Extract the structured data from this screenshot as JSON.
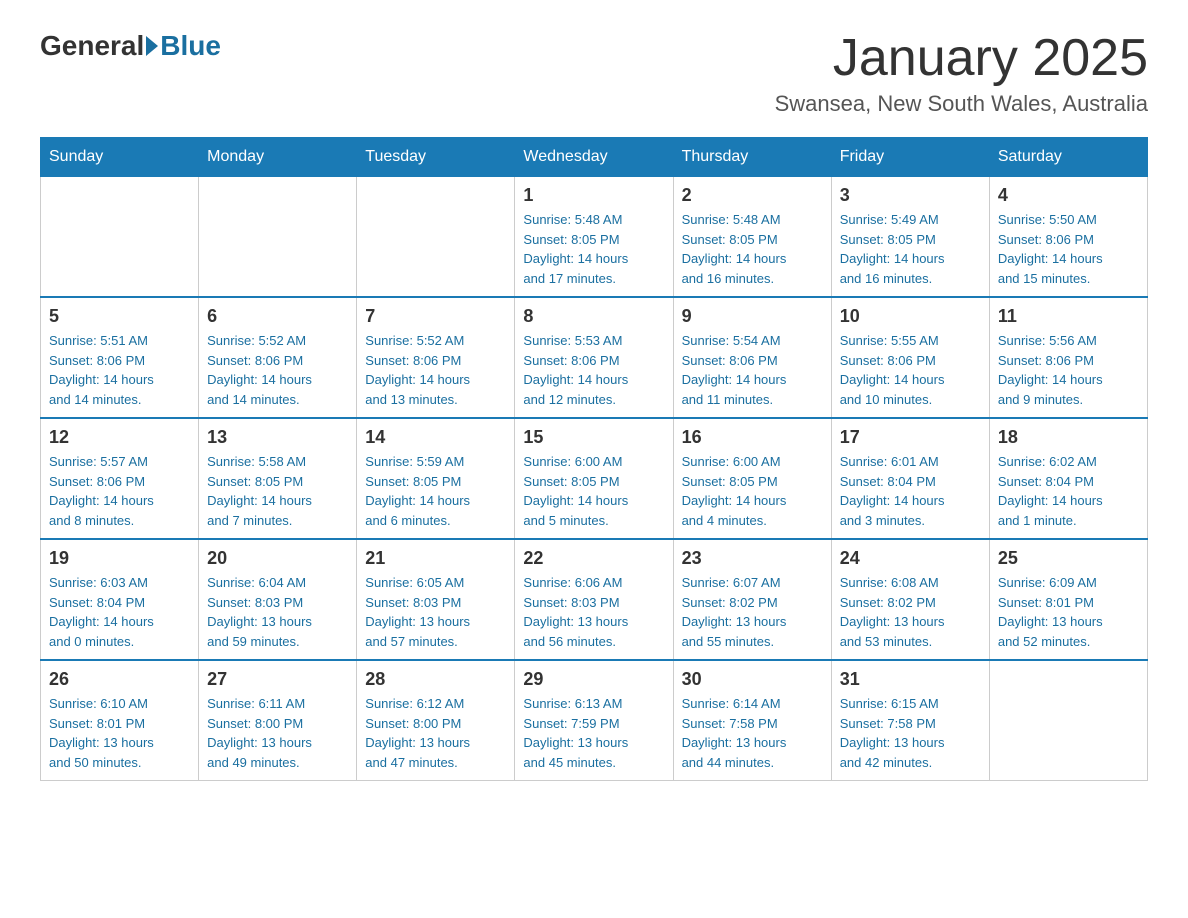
{
  "header": {
    "logo_general": "General",
    "logo_blue": "Blue",
    "month_title": "January 2025",
    "location": "Swansea, New South Wales, Australia"
  },
  "days_of_week": [
    "Sunday",
    "Monday",
    "Tuesday",
    "Wednesday",
    "Thursday",
    "Friday",
    "Saturday"
  ],
  "weeks": [
    [
      {
        "day": "",
        "info": ""
      },
      {
        "day": "",
        "info": ""
      },
      {
        "day": "",
        "info": ""
      },
      {
        "day": "1",
        "info": "Sunrise: 5:48 AM\nSunset: 8:05 PM\nDaylight: 14 hours\nand 17 minutes."
      },
      {
        "day": "2",
        "info": "Sunrise: 5:48 AM\nSunset: 8:05 PM\nDaylight: 14 hours\nand 16 minutes."
      },
      {
        "day": "3",
        "info": "Sunrise: 5:49 AM\nSunset: 8:05 PM\nDaylight: 14 hours\nand 16 minutes."
      },
      {
        "day": "4",
        "info": "Sunrise: 5:50 AM\nSunset: 8:06 PM\nDaylight: 14 hours\nand 15 minutes."
      }
    ],
    [
      {
        "day": "5",
        "info": "Sunrise: 5:51 AM\nSunset: 8:06 PM\nDaylight: 14 hours\nand 14 minutes."
      },
      {
        "day": "6",
        "info": "Sunrise: 5:52 AM\nSunset: 8:06 PM\nDaylight: 14 hours\nand 14 minutes."
      },
      {
        "day": "7",
        "info": "Sunrise: 5:52 AM\nSunset: 8:06 PM\nDaylight: 14 hours\nand 13 minutes."
      },
      {
        "day": "8",
        "info": "Sunrise: 5:53 AM\nSunset: 8:06 PM\nDaylight: 14 hours\nand 12 minutes."
      },
      {
        "day": "9",
        "info": "Sunrise: 5:54 AM\nSunset: 8:06 PM\nDaylight: 14 hours\nand 11 minutes."
      },
      {
        "day": "10",
        "info": "Sunrise: 5:55 AM\nSunset: 8:06 PM\nDaylight: 14 hours\nand 10 minutes."
      },
      {
        "day": "11",
        "info": "Sunrise: 5:56 AM\nSunset: 8:06 PM\nDaylight: 14 hours\nand 9 minutes."
      }
    ],
    [
      {
        "day": "12",
        "info": "Sunrise: 5:57 AM\nSunset: 8:06 PM\nDaylight: 14 hours\nand 8 minutes."
      },
      {
        "day": "13",
        "info": "Sunrise: 5:58 AM\nSunset: 8:05 PM\nDaylight: 14 hours\nand 7 minutes."
      },
      {
        "day": "14",
        "info": "Sunrise: 5:59 AM\nSunset: 8:05 PM\nDaylight: 14 hours\nand 6 minutes."
      },
      {
        "day": "15",
        "info": "Sunrise: 6:00 AM\nSunset: 8:05 PM\nDaylight: 14 hours\nand 5 minutes."
      },
      {
        "day": "16",
        "info": "Sunrise: 6:00 AM\nSunset: 8:05 PM\nDaylight: 14 hours\nand 4 minutes."
      },
      {
        "day": "17",
        "info": "Sunrise: 6:01 AM\nSunset: 8:04 PM\nDaylight: 14 hours\nand 3 minutes."
      },
      {
        "day": "18",
        "info": "Sunrise: 6:02 AM\nSunset: 8:04 PM\nDaylight: 14 hours\nand 1 minute."
      }
    ],
    [
      {
        "day": "19",
        "info": "Sunrise: 6:03 AM\nSunset: 8:04 PM\nDaylight: 14 hours\nand 0 minutes."
      },
      {
        "day": "20",
        "info": "Sunrise: 6:04 AM\nSunset: 8:03 PM\nDaylight: 13 hours\nand 59 minutes."
      },
      {
        "day": "21",
        "info": "Sunrise: 6:05 AM\nSunset: 8:03 PM\nDaylight: 13 hours\nand 57 minutes."
      },
      {
        "day": "22",
        "info": "Sunrise: 6:06 AM\nSunset: 8:03 PM\nDaylight: 13 hours\nand 56 minutes."
      },
      {
        "day": "23",
        "info": "Sunrise: 6:07 AM\nSunset: 8:02 PM\nDaylight: 13 hours\nand 55 minutes."
      },
      {
        "day": "24",
        "info": "Sunrise: 6:08 AM\nSunset: 8:02 PM\nDaylight: 13 hours\nand 53 minutes."
      },
      {
        "day": "25",
        "info": "Sunrise: 6:09 AM\nSunset: 8:01 PM\nDaylight: 13 hours\nand 52 minutes."
      }
    ],
    [
      {
        "day": "26",
        "info": "Sunrise: 6:10 AM\nSunset: 8:01 PM\nDaylight: 13 hours\nand 50 minutes."
      },
      {
        "day": "27",
        "info": "Sunrise: 6:11 AM\nSunset: 8:00 PM\nDaylight: 13 hours\nand 49 minutes."
      },
      {
        "day": "28",
        "info": "Sunrise: 6:12 AM\nSunset: 8:00 PM\nDaylight: 13 hours\nand 47 minutes."
      },
      {
        "day": "29",
        "info": "Sunrise: 6:13 AM\nSunset: 7:59 PM\nDaylight: 13 hours\nand 45 minutes."
      },
      {
        "day": "30",
        "info": "Sunrise: 6:14 AM\nSunset: 7:58 PM\nDaylight: 13 hours\nand 44 minutes."
      },
      {
        "day": "31",
        "info": "Sunrise: 6:15 AM\nSunset: 7:58 PM\nDaylight: 13 hours\nand 42 minutes."
      },
      {
        "day": "",
        "info": ""
      }
    ]
  ]
}
